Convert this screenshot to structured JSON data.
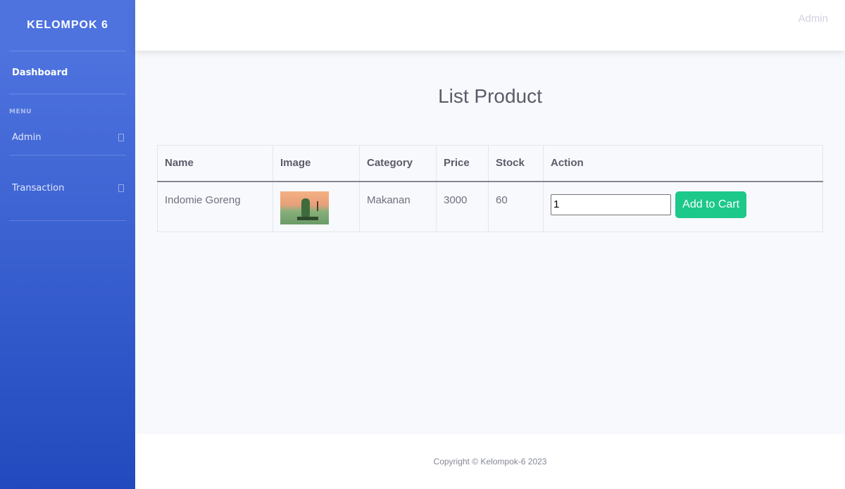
{
  "sidebar": {
    "brand": "KELOMPOK 6",
    "dashboard_label": "Dashboard",
    "heading": "MENU",
    "items": [
      {
        "label": "Admin",
        "icon": "chevron-right-icon"
      },
      {
        "label": "Transaction",
        "icon": "chevron-right-icon"
      }
    ]
  },
  "topbar": {
    "user_name": "Admin"
  },
  "main": {
    "title": "List Product",
    "table": {
      "headers": [
        "Name",
        "Image",
        "Category",
        "Price",
        "Stock",
        "Action"
      ],
      "rows": [
        {
          "name": "Indomie Goreng",
          "category": "Makanan",
          "price": "3000",
          "stock": "60",
          "quantity": "1",
          "button_label": "Add to Cart"
        }
      ]
    }
  },
  "footer": {
    "copyright": "Copyright © Kelompok-6 2023"
  },
  "colors": {
    "sidebar_top": "#4e73df",
    "sidebar_bottom": "#224abe",
    "success": "#1cc88a"
  }
}
